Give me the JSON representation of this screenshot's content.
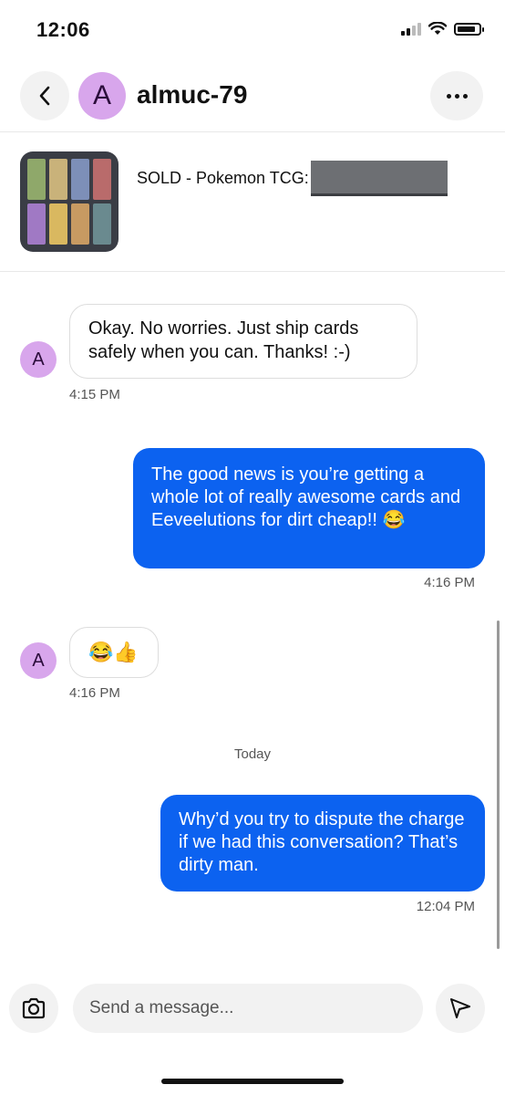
{
  "status_bar": {
    "time": "12:06",
    "battery_level": 0.85
  },
  "header": {
    "avatar_initial": "A",
    "username": "almuc-79"
  },
  "listing": {
    "title": "SOLD - Pokemon TCG:"
  },
  "messages": [
    {
      "from": "them",
      "text": "Okay. No worries. Just ship cards safely when you can. Thanks! :-)",
      "time": "4:15 PM"
    },
    {
      "from": "me",
      "text": "The good news is you’re getting a whole lot of really awesome cards and Eeveelutions for dirt cheap!! 😂",
      "time": "4:16 PM"
    },
    {
      "from": "them",
      "text": "😂👍",
      "time": "4:16 PM"
    },
    {
      "from": "me",
      "text": "Why’d you try to dispute the charge if we had this conversation? That’s dirty man.",
      "time": "12:04 PM"
    }
  ],
  "day_separator": "Today",
  "composer": {
    "placeholder": "Send a message..."
  },
  "colors": {
    "outgoing_bubble": "#0c62f0",
    "avatar_bg": "#d8a6ec"
  }
}
